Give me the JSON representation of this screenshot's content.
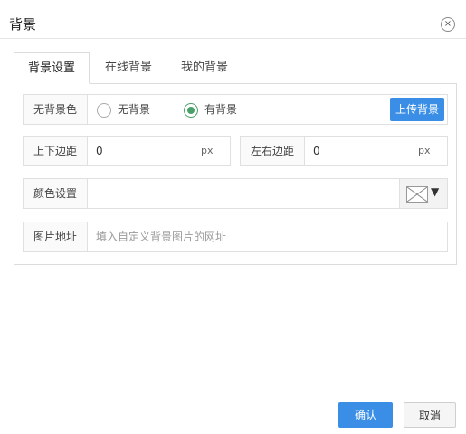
{
  "dialog": {
    "title": "背景",
    "close_glyph": "×"
  },
  "tabs": [
    {
      "label": "背景设置",
      "active": true
    },
    {
      "label": "在线背景",
      "active": false
    },
    {
      "label": "我的背景",
      "active": false
    }
  ],
  "form": {
    "background_mode": {
      "label": "无背景色",
      "options": [
        {
          "label": "无背景",
          "checked": false
        },
        {
          "label": "有背景",
          "checked": true
        }
      ],
      "upload_label": "上传背景"
    },
    "vertical_margin": {
      "label": "上下边距",
      "value": "0",
      "unit": "px"
    },
    "horizontal_margin": {
      "label": "左右边距",
      "value": "0",
      "unit": "px"
    },
    "color": {
      "label": "颜色设置",
      "caret": "▼"
    },
    "image_url": {
      "label": "图片地址",
      "placeholder": "填入自定义背景图片的网址"
    }
  },
  "footer": {
    "ok_label": "确认",
    "cancel_label": "取消"
  },
  "colors": {
    "accent": "#3a8ee6",
    "radio_checked": "#4aa06a"
  }
}
